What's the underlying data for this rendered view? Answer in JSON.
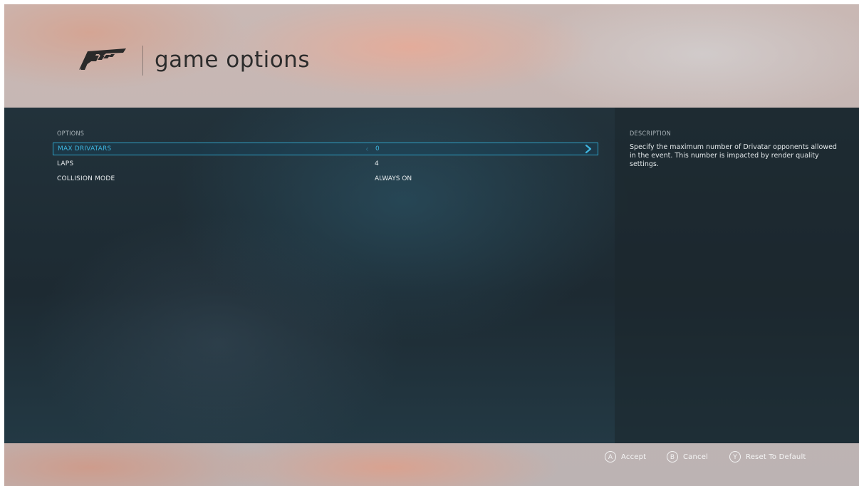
{
  "header": {
    "title": "game options"
  },
  "options": {
    "section_label": "OPTIONS",
    "items": [
      {
        "label": "MAX DRIVATARS",
        "value": "0",
        "selected": true
      },
      {
        "label": "LAPS",
        "value": "4",
        "selected": false
      },
      {
        "label": "COLLISION MODE",
        "value": "ALWAYS ON",
        "selected": false
      }
    ]
  },
  "description": {
    "section_label": "DESCRIPTION",
    "text": "Specify the maximum number of Drivatar opponents allowed in the event. This number is impacted by render quality settings."
  },
  "footer": {
    "actions": [
      {
        "button": "A",
        "label": "Accept"
      },
      {
        "button": "B",
        "label": "Cancel"
      },
      {
        "button": "Y",
        "label": "Reset To Default"
      }
    ]
  },
  "colors": {
    "accent": "#3fb6e0",
    "selection_border": "#2e9fc4",
    "panel_bg": "#1d2a32",
    "title_text": "#2c2c2c"
  },
  "icons": {
    "logo": "forza-logo",
    "next": "chevron-right-icon",
    "prev": "chevron-left-icon"
  }
}
